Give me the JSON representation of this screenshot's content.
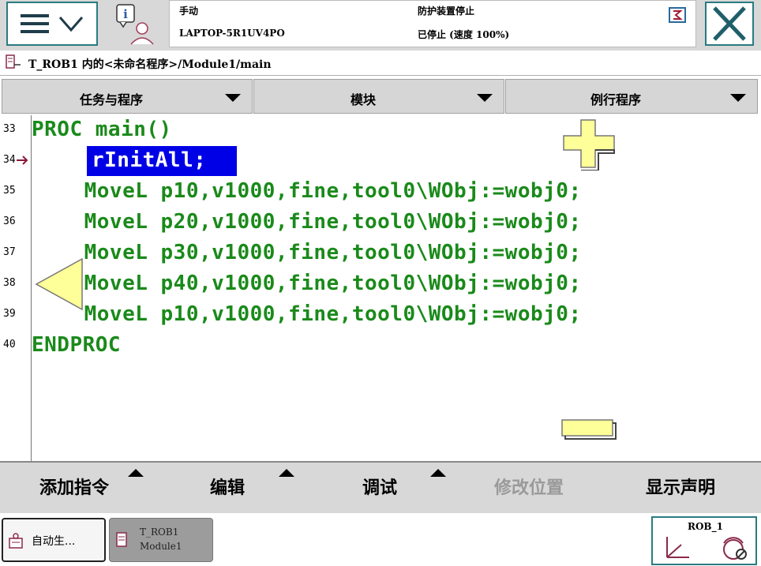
{
  "status": {
    "mode": "手动",
    "controller": "LAPTOP-5R1UV4PO",
    "safety": "防护装置停止",
    "run_state": "已停止 (速度 100%)"
  },
  "path": "T_ROB1 内的<未命名程序>/Module1/main",
  "tabs": [
    {
      "label": "任务与程序"
    },
    {
      "label": "模块"
    },
    {
      "label": "例行程序"
    }
  ],
  "code_lines": [
    {
      "num": "33",
      "text": "PROC main()"
    },
    {
      "num": "34",
      "text": "rInitAll;"
    },
    {
      "num": "35",
      "text": "    MoveL p10,v1000,fine,tool0\\WObj:=wobj0;"
    },
    {
      "num": "36",
      "text": "    MoveL p20,v1000,fine,tool0\\WObj:=wobj0;"
    },
    {
      "num": "37",
      "text": "    MoveL p30,v1000,fine,tool0\\WObj:=wobj0;"
    },
    {
      "num": "38",
      "text": "    MoveL p40,v1000,fine,tool0\\WObj:=wobj0;"
    },
    {
      "num": "39",
      "text": "    MoveL p10,v1000,fine,tool0\\WObj:=wobj0;"
    },
    {
      "num": "40",
      "text": "ENDPROC"
    }
  ],
  "bottom_menu": {
    "add_instruction": "添加指令",
    "edit": "编辑",
    "debug": "调试",
    "modify_position": "修改位置",
    "show_declaration": "显示声明"
  },
  "taskbar": {
    "task1": "自动生...",
    "task2_line1": "T_ROB1",
    "task2_line2": "Module1",
    "robot": "ROB_1"
  },
  "colors": {
    "code": "#1a8a1a",
    "selection": "#0000e6",
    "accent_border": "#2a7b80",
    "zoom_controls": "#ffff99"
  },
  "icons": [
    "hamburger-menu-icon",
    "chevron-down-icon",
    "info-user-icon",
    "status-indicator-icon",
    "close-icon",
    "program-file-icon",
    "program-pointer-icon",
    "zoom-in-icon",
    "zoom-out-icon",
    "scroll-left-icon",
    "robot-axes-icon",
    "jog-mode-icon"
  ]
}
